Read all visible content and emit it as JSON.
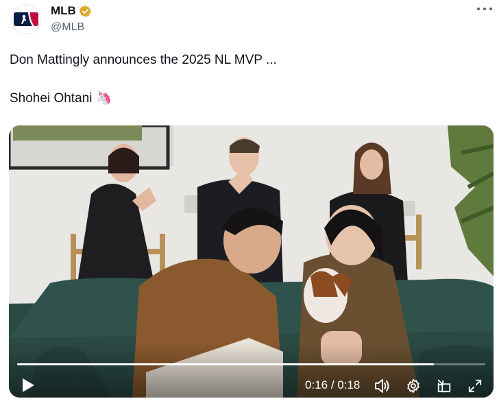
{
  "account": {
    "display_name": "MLB",
    "handle": "@MLB",
    "verified": true,
    "avatar_icon": "mlb-logo-icon",
    "badge_color": "#e0a82e"
  },
  "tweet": {
    "line1": "Don Mattingly announces the 2025 NL MVP ...",
    "line2": "Shohei Ohtani 🦄"
  },
  "video": {
    "current_time": "0:16",
    "separator": "/",
    "duration": "0:18",
    "progress": 0.89,
    "icons": [
      "play-icon",
      "volume-icon",
      "settings-icon",
      "pip-icon",
      "fullscreen-icon"
    ]
  },
  "colors": {
    "text": "#0f1419",
    "secondary": "#536471",
    "mlb_blue": "#041e42",
    "mlb_red": "#bf0d3e"
  }
}
